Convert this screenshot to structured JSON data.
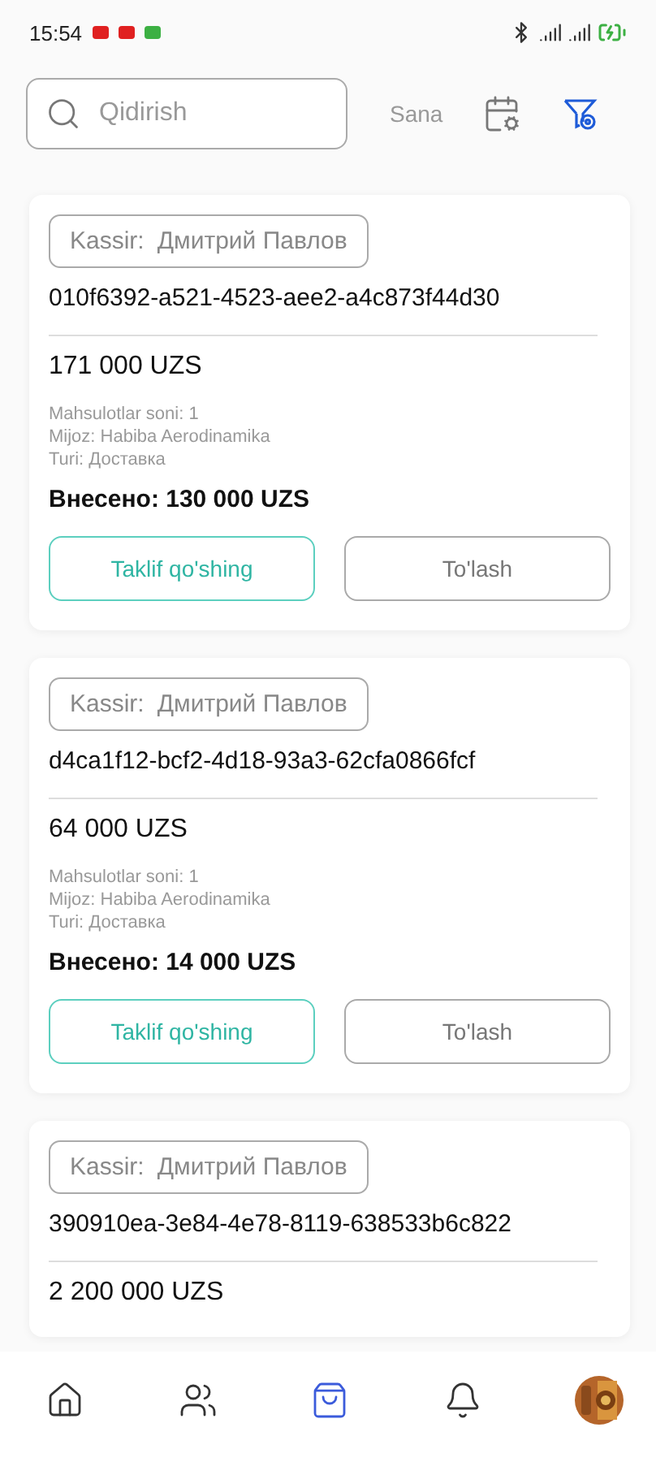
{
  "status_bar": {
    "time": "15:54"
  },
  "search": {
    "placeholder": "Qidirish"
  },
  "date_filter": {
    "label": "Sana"
  },
  "orders": [
    {
      "cashier_label": "Kassir:",
      "cashier": "Дмитрий Павлов",
      "id": "010f6392-a521-4523-aee2-a4c873f44d30",
      "amount": "171 000 UZS",
      "details": [
        "Mahsulotlar soni: 1",
        "Mijoz: Habiba Aerodinamika",
        "Turi: Доставка"
      ],
      "paid": "Внесено: 130 000 UZS",
      "buttons": [
        {
          "label": "Taklif qo'shing",
          "kind": "primary"
        },
        {
          "label": "To'lash",
          "kind": "secondary"
        }
      ]
    },
    {
      "cashier_label": "Kassir:",
      "cashier": "Дмитрий Павлов",
      "id": "d4ca1f12-bcf2-4d18-93a3-62cfa0866fcf",
      "amount": "64 000 UZS",
      "details": [
        "Mahsulotlar soni: 1",
        "Mijoz: Habiba Aerodinamika",
        "Turi: Доставка"
      ],
      "paid": "Внесено: 14 000 UZS",
      "buttons": [
        {
          "label": "Taklif qo'shing",
          "kind": "primary"
        },
        {
          "label": "To'lash",
          "kind": "secondary"
        }
      ]
    },
    {
      "cashier_label": "Kassir:",
      "cashier": "Дмитрий Павлов",
      "id": "390910ea-3e84-4e78-8119-638533b6c822",
      "amount": "2 200 000 UZS"
    }
  ],
  "nav": [
    {
      "kind": "home",
      "selected": false
    },
    {
      "kind": "people",
      "selected": false
    },
    {
      "kind": "bag",
      "selected": true
    },
    {
      "kind": "bell",
      "selected": false
    },
    {
      "kind": "avatar",
      "selected": false
    }
  ]
}
